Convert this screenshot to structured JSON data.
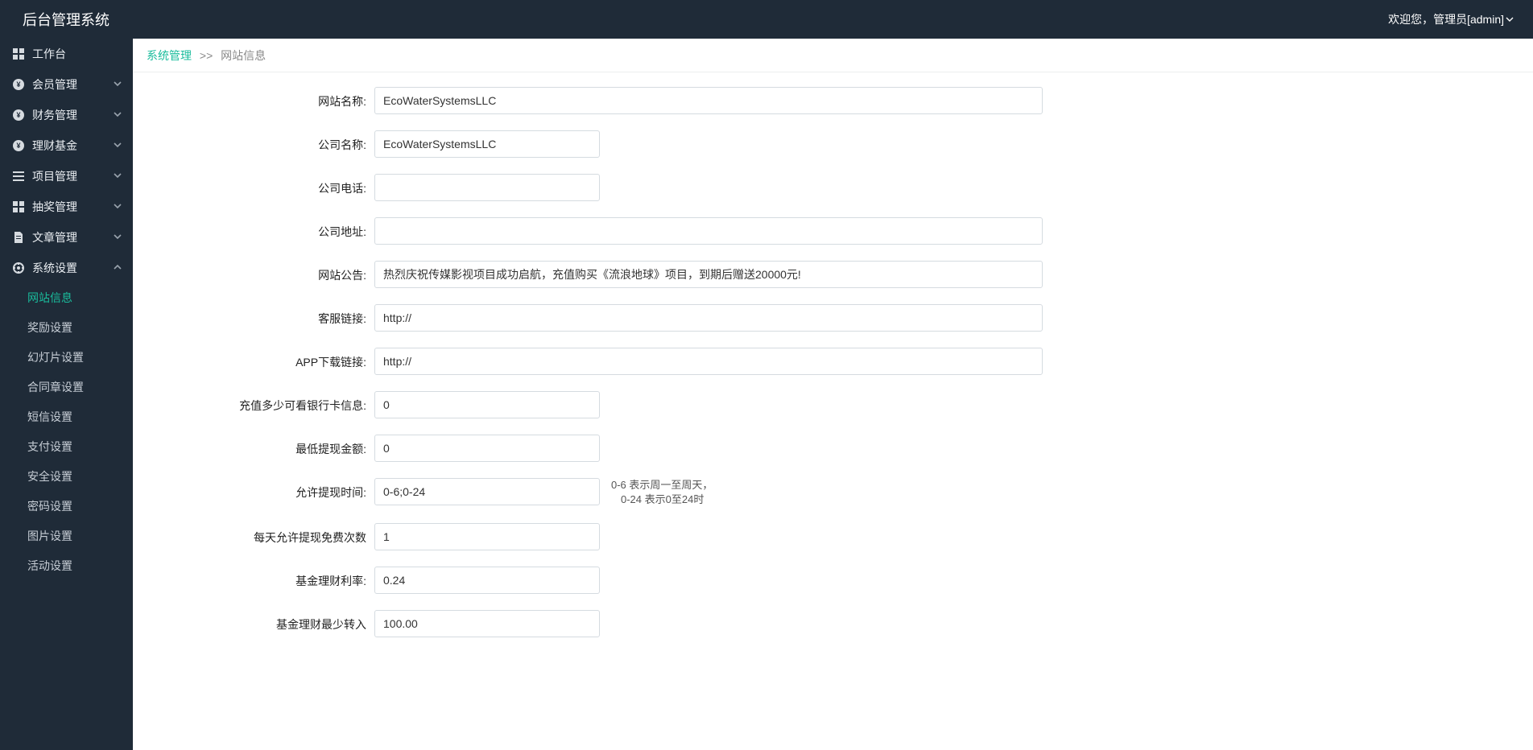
{
  "header": {
    "brand": "后台管理系统",
    "welcome_prefix": "欢迎您，",
    "role_label": "管理员",
    "username": "admin"
  },
  "sidebar": {
    "items": [
      {
        "icon": "grid",
        "label": "工作台",
        "expandable": false
      },
      {
        "icon": "yen",
        "label": "会员管理",
        "expandable": true
      },
      {
        "icon": "yen",
        "label": "财务管理",
        "expandable": true
      },
      {
        "icon": "yen",
        "label": "理财基金",
        "expandable": true
      },
      {
        "icon": "list",
        "label": "项目管理",
        "expandable": true
      },
      {
        "icon": "grid",
        "label": "抽奖管理",
        "expandable": true
      },
      {
        "icon": "doc",
        "label": "文章管理",
        "expandable": true
      },
      {
        "icon": "gear",
        "label": "系统设置",
        "expandable": true,
        "expanded": true
      }
    ],
    "system_sub": [
      {
        "label": "网站信息",
        "active": true
      },
      {
        "label": "奖励设置"
      },
      {
        "label": "幻灯片设置"
      },
      {
        "label": "合同章设置"
      },
      {
        "label": "短信设置"
      },
      {
        "label": "支付设置"
      },
      {
        "label": "安全设置"
      },
      {
        "label": "密码设置"
      },
      {
        "label": "图片设置"
      },
      {
        "label": "活动设置"
      }
    ]
  },
  "breadcrumb": {
    "parent": "系统管理",
    "sep": ">>",
    "current": "网站信息"
  },
  "form": {
    "fields": [
      {
        "key": "site_name",
        "label": "网站名称:",
        "width": "wide",
        "value": "EcoWaterSystemsLLC"
      },
      {
        "key": "company_name",
        "label": "公司名称:",
        "width": "norm",
        "value": "EcoWaterSystemsLLC"
      },
      {
        "key": "company_phone",
        "label": "公司电话:",
        "width": "norm",
        "value": ""
      },
      {
        "key": "company_address",
        "label": "公司地址:",
        "width": "wide",
        "value": ""
      },
      {
        "key": "site_notice",
        "label": "网站公告:",
        "width": "wide",
        "value": "热烈庆祝传媒影视项目成功启航，充值购买《流浪地球》项目，到期后赠送20000元!"
      },
      {
        "key": "kefu_link",
        "label": "客服链接:",
        "width": "wide",
        "value": "http://"
      },
      {
        "key": "app_link",
        "label": "APP下载链接:",
        "width": "wide",
        "value": "http://"
      },
      {
        "key": "recharge_view_bank",
        "label": "充值多少可看银行卡信息:",
        "width": "norm",
        "value": "0"
      },
      {
        "key": "min_withdraw",
        "label": "最低提现金额:",
        "width": "norm",
        "value": "0"
      },
      {
        "key": "allow_withdraw_time",
        "label": "允许提现时间:",
        "width": "norm",
        "value": "0-6;0-24",
        "hint1": "0-6 表示周一至周天，",
        "hint2": "0-24 表示0至24时"
      },
      {
        "key": "daily_free_count",
        "label": "每天允许提现免费次数",
        "width": "norm",
        "value": "1"
      },
      {
        "key": "fund_rate",
        "label": "基金理财利率:",
        "width": "norm",
        "value": "0.24"
      },
      {
        "key": "fund_min_transfer",
        "label": "基金理财最少转入",
        "width": "norm",
        "value": "100.00"
      }
    ]
  }
}
